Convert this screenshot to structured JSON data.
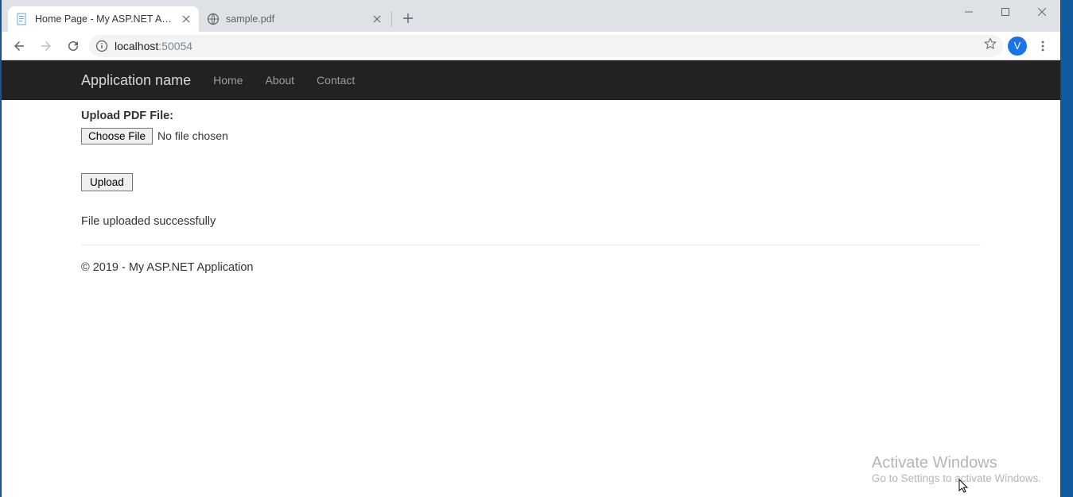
{
  "browser": {
    "tabs": [
      {
        "title": "Home Page - My ASP.NET Applic",
        "active": true
      },
      {
        "title": "sample.pdf",
        "active": false
      }
    ],
    "address": {
      "host": "localhost",
      "port": ":50054"
    },
    "profile_initial": "V"
  },
  "navbar": {
    "brand": "Application name",
    "links": [
      "Home",
      "About",
      "Contact"
    ]
  },
  "page": {
    "upload_label": "Upload PDF File:",
    "choose_file_label": "Choose File",
    "file_status": "No file chosen",
    "upload_button": "Upload",
    "message": "File uploaded successfully",
    "footer": "© 2019 - My ASP.NET Application"
  },
  "watermark": {
    "title": "Activate Windows",
    "subtitle": "Go to Settings to activate Windows."
  }
}
